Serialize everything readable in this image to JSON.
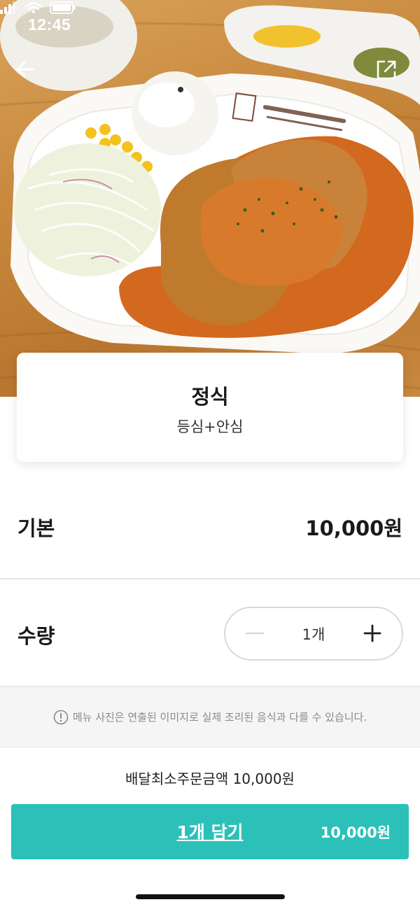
{
  "status_bar": {
    "time": "12:45"
  },
  "icons": {
    "back": "arrow-left-icon",
    "share": "share-external-icon",
    "notice": "exclamation-circle-icon",
    "plus": "plus-icon",
    "minus": "minus-icon"
  },
  "menu": {
    "name": "정식",
    "description": "등심+안심"
  },
  "price_row": {
    "label": "기본",
    "value": "10,000원"
  },
  "quantity_row": {
    "label": "수량",
    "value": "1개",
    "minus_enabled": false
  },
  "notice": {
    "text": "메뉴 사진은 연출된 이미지로 실제 조리된 음식과 다를 수 있습니다."
  },
  "min_order": {
    "text": "배달최소주문금액 10,000원"
  },
  "cart_button": {
    "label": "1개 담기",
    "price": "10,000원"
  },
  "colors": {
    "accent": "#2bc1b9",
    "divider": "#e6e6e6",
    "notice_bg": "#f5f5f5"
  }
}
